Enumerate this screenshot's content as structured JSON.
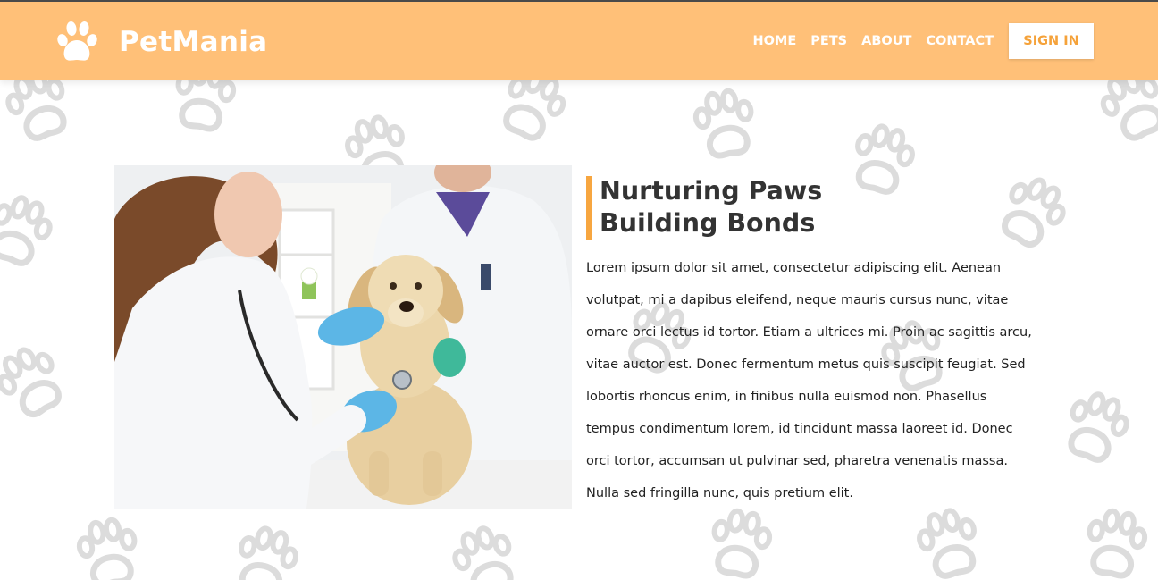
{
  "brand": {
    "name": "PetMania",
    "logo_icon": "paw-icon"
  },
  "nav": {
    "items": [
      {
        "label": "HOME"
      },
      {
        "label": "PETS"
      },
      {
        "label": "ABOUT"
      },
      {
        "label": "CONTACT"
      }
    ],
    "signin_label": "SIGN IN"
  },
  "hero": {
    "heading_lines": [
      "Nurturing Paws",
      "Building Bonds"
    ],
    "body_lines": [
      "Lorem ipsum dolor sit amet, consectetur adipiscing elit. Aenean",
      "volutpat, mi a dapibus eleifend, neque mauris cursus nunc, vitae",
      "ornare orci lectus id tortor. Etiam a ultrices mi. Proin ac sagittis arcu,",
      "vitae auctor est. Donec fermentum metus quis suscipit feugiat. Sed",
      "lobortis rhoncus enim, in finibus nulla euismod non. Phasellus",
      "tempus condimentum lorem, id tincidunt massa laoreet id. Donec",
      "orci tortor, accumsan ut pulvinar sed, pharetra venenatis massa.",
      "Nulla sed fringilla nunc, quis pretium elit."
    ]
  },
  "colors": {
    "navbar": "#ffc078",
    "accent": "#f7a640",
    "signin_text": "#f5a23a",
    "heading": "#333333",
    "paw_pattern": "#dcdcdc"
  }
}
